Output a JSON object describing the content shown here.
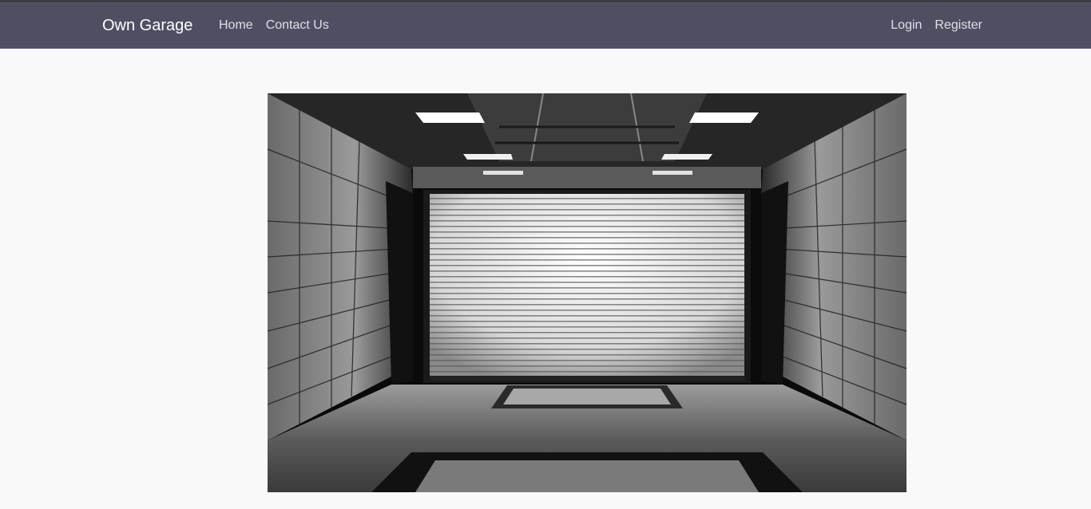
{
  "navbar": {
    "brand": "Own Garage",
    "left_links": [
      "Home",
      "Contact Us"
    ],
    "right_links": [
      "Login",
      "Register"
    ]
  },
  "hero": {
    "image": "garage-shutter-photo"
  }
}
